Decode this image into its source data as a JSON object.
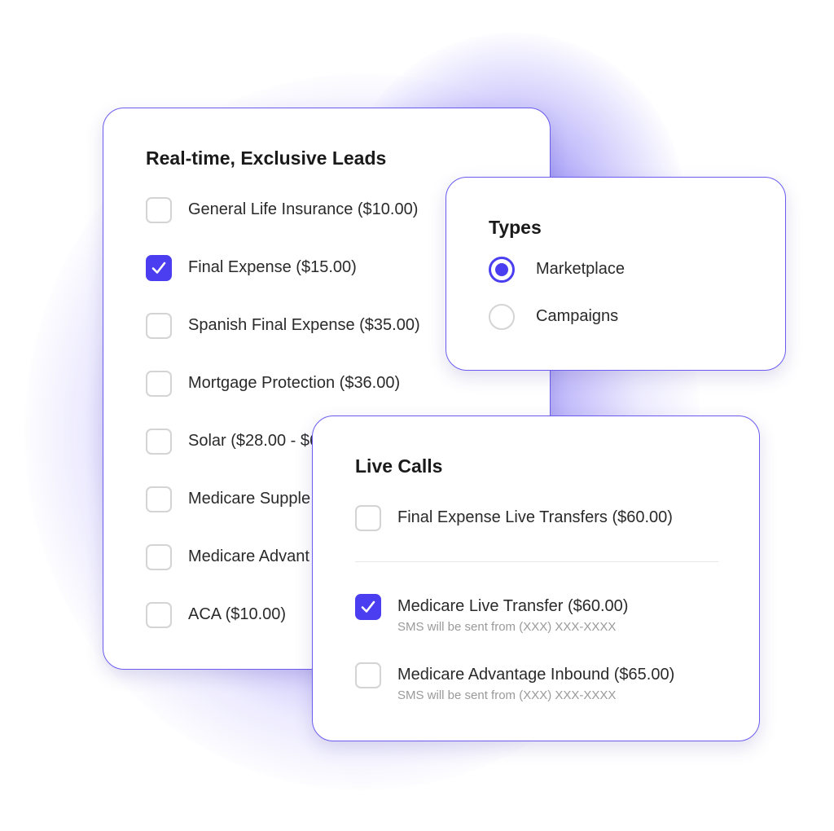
{
  "leads_card": {
    "title": "Real-time, Exclusive Leads",
    "items": [
      {
        "label": "General Life Insurance ($10.00)",
        "checked": false
      },
      {
        "label": "Final Expense ($15.00)",
        "checked": true
      },
      {
        "label": "Spanish Final Expense ($35.00)",
        "checked": false
      },
      {
        "label": "Mortgage Protection ($36.00)",
        "checked": false
      },
      {
        "label": "Solar ($28.00 - $6",
        "checked": false
      },
      {
        "label": "Medicare Supple",
        "checked": false
      },
      {
        "label": "Medicare Advant",
        "checked": false
      },
      {
        "label": "ACA ($10.00)",
        "checked": false
      }
    ]
  },
  "types_card": {
    "title": "Types",
    "options": [
      {
        "label": "Marketplace",
        "selected": true
      },
      {
        "label": "Campaigns",
        "selected": false
      }
    ]
  },
  "live_calls_card": {
    "title": "Live Calls",
    "items": [
      {
        "label": "Final Expense Live Transfers ($60.00)",
        "checked": false,
        "sublabel": ""
      },
      {
        "label": "Medicare Live Transfer ($60.00)",
        "checked": true,
        "sublabel": "SMS will be sent from (XXX) XXX-XXXX"
      },
      {
        "label": "Medicare Advantage Inbound ($65.00)",
        "checked": false,
        "sublabel": "SMS will be sent from (XXX) XXX-XXXX"
      }
    ]
  },
  "colors": {
    "accent": "#4a3ef0",
    "card_border": "#6a5cf0",
    "checkbox_border": "#d4d4d4",
    "muted_text": "#9a9a9a"
  }
}
